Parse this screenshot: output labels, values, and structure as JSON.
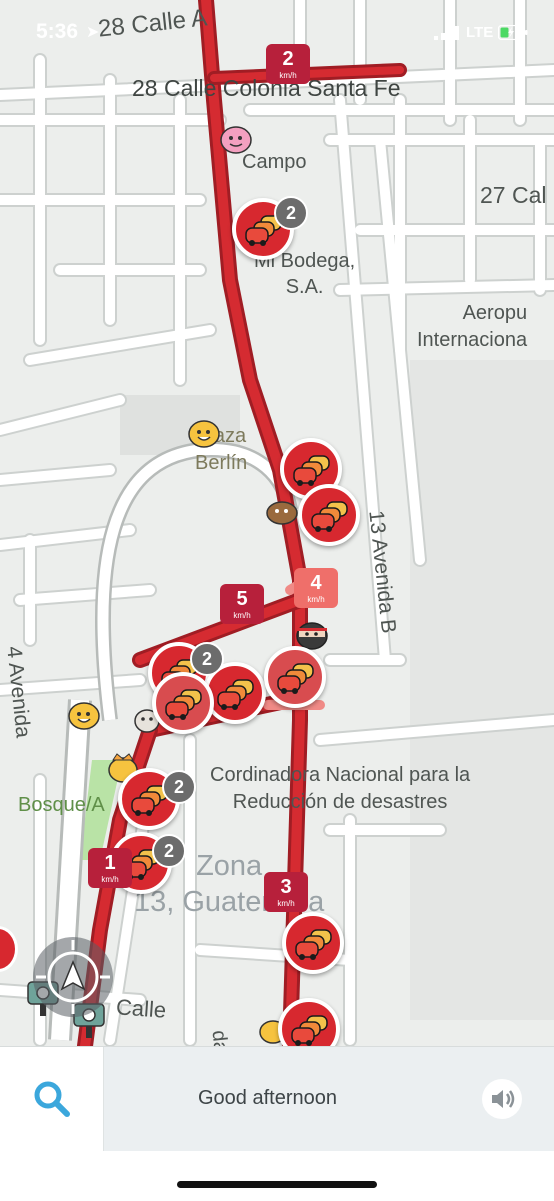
{
  "status_bar": {
    "time": "5:36",
    "network": "LTE"
  },
  "map": {
    "labels": {
      "street_28_calle_a": "28 Calle A",
      "street_28_calle_colonia": "28 Calle Colonia Santa Fe",
      "campo": "Campo",
      "street_27_calle": "27 Cal",
      "bodega_line1": "Mi Bodega,",
      "bodega_line2": "S.A.",
      "aeropuerto_line1": "Aeropu",
      "aeropuerto_line2": "Internaciona",
      "plaza_line1": "Plaza",
      "plaza_line2": "Berlín",
      "avenida_13b": "13 Avenida B",
      "avenida_4": "4 Avenida",
      "cordinadora_line1": "Cordinadora Nacional para la",
      "cordinadora_line2": "Reducción de desastres",
      "bosque": "Bosque/A",
      "zona_line1": "Zona",
      "zona_line2": "13, Guatemala",
      "calle_bottom": "Calle",
      "road_bottom": "da"
    },
    "speed_unit": "km/h",
    "speed_markers": [
      {
        "value": "2",
        "color": "#b7203b"
      },
      {
        "value": "5",
        "color": "#b7203b"
      },
      {
        "value": "4",
        "color": "#ef6f6a"
      },
      {
        "value": "3",
        "color": "#b7203b"
      },
      {
        "value": "1",
        "color": "#b7203b"
      }
    ],
    "jam_counts": [
      "2",
      "2",
      "2",
      "2"
    ],
    "colors": {
      "road_jam": "#c8262c",
      "road_light": "#ef6f6a",
      "jam_marker": "#d7282f",
      "speed_badge": "#b7203b",
      "accent_search": "#3ba7dc"
    }
  },
  "bottom_bar": {
    "greeting": "Good afternoon",
    "search_icon": "search-icon",
    "speaker_icon": "speaker-icon"
  }
}
